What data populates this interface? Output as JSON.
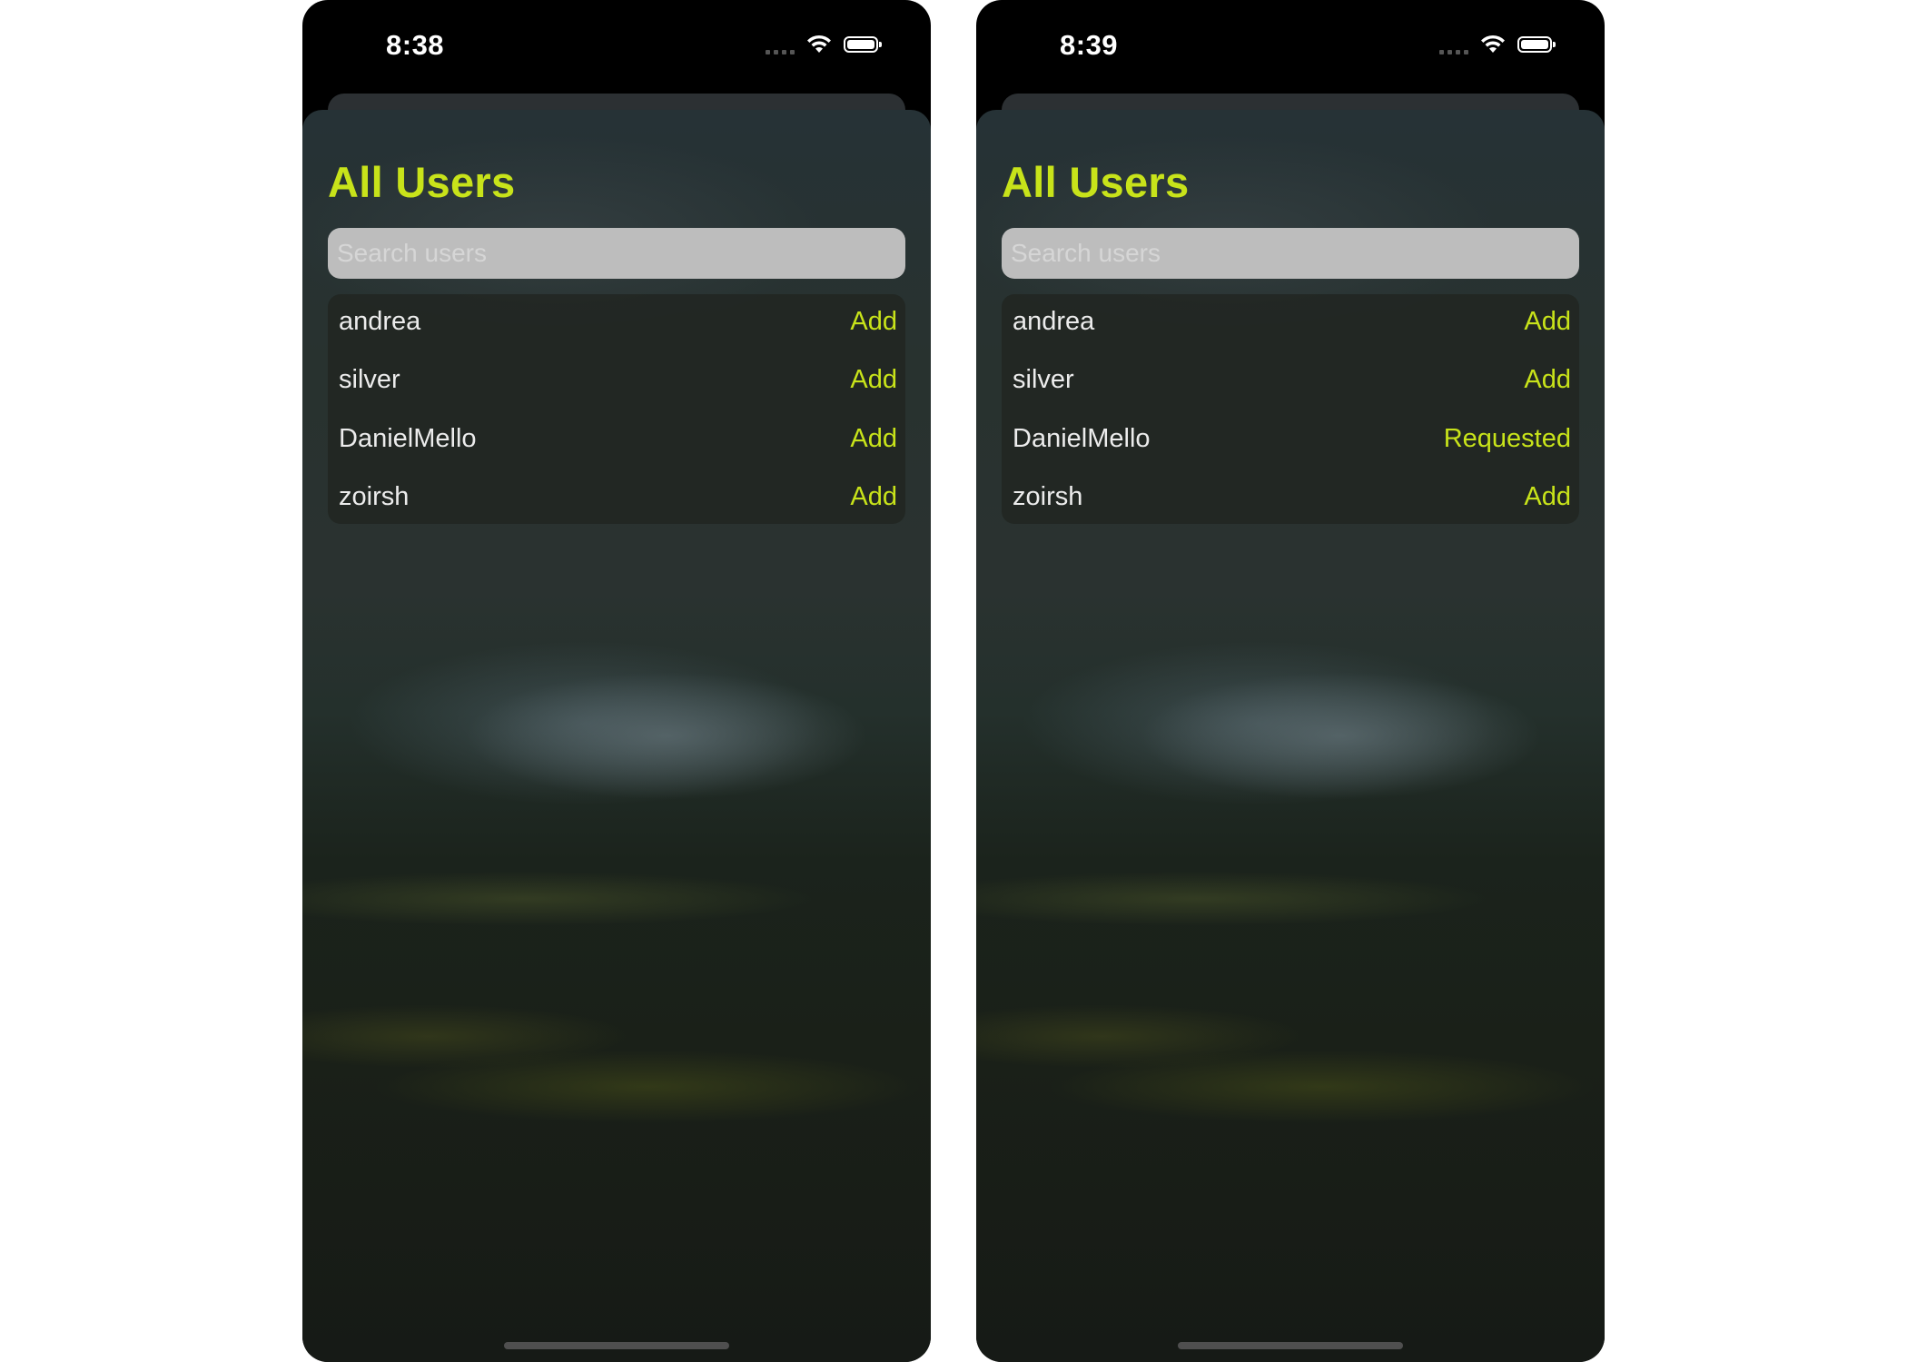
{
  "accent_color": "#c8e31a",
  "screens": [
    {
      "status_bar": {
        "time": "8:38",
        "icons": [
          "cellular-signal-icon",
          "wifi-icon",
          "battery-icon"
        ]
      },
      "title": "All Users",
      "search": {
        "placeholder": "Search users",
        "value": ""
      },
      "users": [
        {
          "name": "andrea",
          "action": "Add"
        },
        {
          "name": "silver",
          "action": "Add"
        },
        {
          "name": "DanielMello",
          "action": "Add"
        },
        {
          "name": "zoirsh",
          "action": "Add"
        }
      ]
    },
    {
      "status_bar": {
        "time": "8:39",
        "icons": [
          "cellular-signal-icon",
          "wifi-icon",
          "battery-icon"
        ]
      },
      "title": "All Users",
      "search": {
        "placeholder": "Search users",
        "value": ""
      },
      "users": [
        {
          "name": "andrea",
          "action": "Add"
        },
        {
          "name": "silver",
          "action": "Add"
        },
        {
          "name": "DanielMello",
          "action": "Requested"
        },
        {
          "name": "zoirsh",
          "action": "Add"
        }
      ]
    }
  ]
}
